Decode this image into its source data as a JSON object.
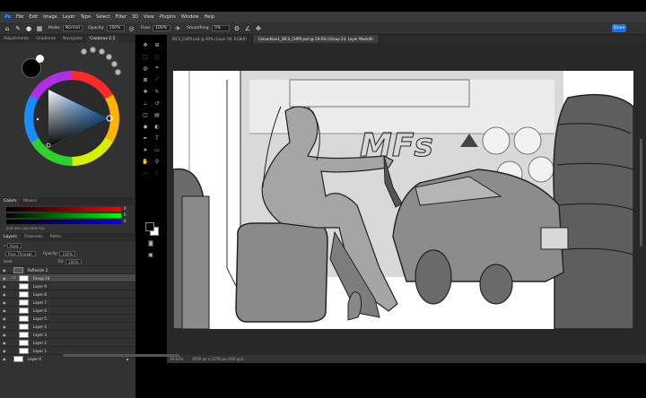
{
  "menu": [
    "File",
    "Edit",
    "Image",
    "Layer",
    "Type",
    "Select",
    "Filter",
    "3D",
    "View",
    "Plugins",
    "Window",
    "Help"
  ],
  "options": {
    "mode_label": "Mode:",
    "mode_value": "Normal",
    "opacity_label": "Opacity:",
    "opacity_value": "100%",
    "flow_label": "Flow:",
    "flow_value": "100%",
    "smoothing_label": "Smoothing:",
    "smoothing_value": "0%",
    "share_label": "Share"
  },
  "left_tabs": [
    "Adjustments",
    "Gradients",
    "Navigator",
    "Coolorus 2.5"
  ],
  "left_tab_active": 3,
  "color_tabs": [
    "Colors",
    "Mixers"
  ],
  "slider_values": [
    "0",
    "0",
    "0"
  ],
  "slider_modes": "RGB HSV LAB CMYK YUV",
  "layers_tabs": [
    "Layers",
    "Channels",
    "Paths"
  ],
  "layers": {
    "filter_label": "Kind",
    "blend_label": "Pass Through",
    "opacity_label": "Opacity:",
    "opacity_value": "100%",
    "lock_label": "Lock:",
    "fill_label": "Fill:",
    "fill_value": "100%",
    "items": [
      {
        "name": "Reflexión 2"
      },
      {
        "name": "Group 24"
      },
      {
        "name": "Layer 9"
      },
      {
        "name": "Layer 8"
      },
      {
        "name": "Layer 7"
      },
      {
        "name": "Layer 6"
      },
      {
        "name": "Layer 5"
      },
      {
        "name": "Layer 4"
      },
      {
        "name": "Layer 3"
      },
      {
        "name": "Layer 2"
      },
      {
        "name": "Layer 1"
      },
      {
        "name": "Layer 0"
      }
    ]
  },
  "doc_tabs": [
    "IBCS_CHPR.psd @ 40% (Layer 96, RGB/8)",
    "Colourblue1_IBCS_CHPR.psd @ 29.6% (Group 24, Layer Mask/8)"
  ],
  "doc_tab_active": 1,
  "status": {
    "zoom": "29.63%",
    "size": "4050 px x 2278 px (300 ppi)"
  },
  "art_text": "MFs",
  "colors": {
    "accent": "#1473e6",
    "panel": "#323232"
  }
}
